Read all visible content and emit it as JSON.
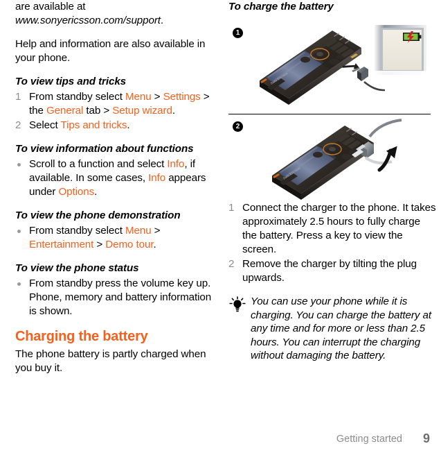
{
  "left_column": {
    "intro_paragraph_1": {
      "line1": "are available at ",
      "url": "www.sonyericsson.com/support",
      "period": "."
    },
    "intro_paragraph_2": "Help and information are also available in your phone.",
    "section_tips": {
      "heading": "To view tips and tricks",
      "steps": [
        {
          "num": "1",
          "parts": [
            {
              "t": "From standby select ",
              "c": "black"
            },
            {
              "t": "Menu",
              "c": "orange"
            },
            {
              "t": " > ",
              "c": "black"
            },
            {
              "t": "Settings",
              "c": "orange"
            },
            {
              "t": " > the ",
              "c": "black"
            },
            {
              "t": "General",
              "c": "orange"
            },
            {
              "t": " tab > ",
              "c": "black"
            },
            {
              "t": "Setup wizard",
              "c": "orange"
            },
            {
              "t": ".",
              "c": "black"
            }
          ]
        },
        {
          "num": "2",
          "parts": [
            {
              "t": "Select ",
              "c": "black"
            },
            {
              "t": "Tips and tricks",
              "c": "orange"
            },
            {
              "t": ".",
              "c": "black"
            }
          ]
        }
      ]
    },
    "section_functions": {
      "heading": "To view information about functions",
      "bullets": [
        {
          "parts": [
            {
              "t": "Scroll to a function and select ",
              "c": "black"
            },
            {
              "t": "Info",
              "c": "orange"
            },
            {
              "t": ", if available. In some cases, ",
              "c": "black"
            },
            {
              "t": "Info",
              "c": "orange"
            },
            {
              "t": " appears under ",
              "c": "black"
            },
            {
              "t": "Options",
              "c": "orange"
            },
            {
              "t": ".",
              "c": "black"
            }
          ]
        }
      ]
    },
    "section_demo": {
      "heading": "To view the phone demonstration",
      "bullets": [
        {
          "parts": [
            {
              "t": "From standby select ",
              "c": "black"
            },
            {
              "t": "Menu",
              "c": "orange"
            },
            {
              "t": " > ",
              "c": "black"
            },
            {
              "t": "Entertainment",
              "c": "orange"
            },
            {
              "t": " > ",
              "c": "black"
            },
            {
              "t": "Demo tour",
              "c": "orange"
            },
            {
              "t": ".",
              "c": "black"
            }
          ]
        }
      ]
    },
    "section_status": {
      "heading": "To view the phone status",
      "bullets": [
        {
          "parts": [
            {
              "t": "From standby press the volume key up. Phone, memory and battery information is shown.",
              "c": "black"
            }
          ]
        }
      ]
    },
    "section_charging": {
      "heading": "Charging the battery",
      "paragraph": "The phone battery is partly charged when you buy it."
    }
  },
  "right_column": {
    "heading": "To charge the battery",
    "illustrations": [
      {
        "badge": "1",
        "caption_icon": "phone-with-charger-illustration",
        "inset_icon": "battery-charging-screen-icon"
      },
      {
        "badge": "2",
        "caption_icon": "phone-remove-charger-illustration"
      }
    ],
    "steps": [
      {
        "num": "1",
        "text": "Connect the charger to the phone. It takes approximately 2.5 hours to fully charge the battery. Press a key to view the screen."
      },
      {
        "num": "2",
        "text": "Remove the charger by tilting the plug upwards."
      }
    ],
    "tip": {
      "icon": "lightbulb-tip-icon",
      "text": "You can use your phone while it is charging. You can charge the battery at any time and for more or less than 2.5 hours. You can interrupt the charging without damaging the battery."
    }
  },
  "footer": {
    "section_label": "Getting started",
    "page_number": "9"
  },
  "colors": {
    "accent_orange": "#F4601E",
    "muted_gray": "#8C8C8C",
    "body_black": "#000000"
  }
}
